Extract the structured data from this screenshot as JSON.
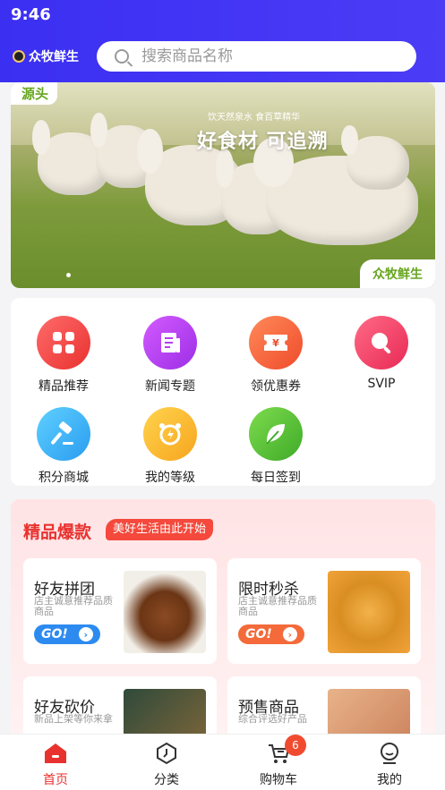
{
  "status": {
    "time": "9:46"
  },
  "header": {
    "brand": "众牧鲜生"
  },
  "search": {
    "placeholder": "搜索商品名称"
  },
  "banner": {
    "corner_tag": "源头",
    "subtitle": "饮天然泉水 食百草精华",
    "title": "好食材 可追溯",
    "brand": "众牧鲜生"
  },
  "menu": [
    {
      "label": "精品推荐",
      "icon": "grid-icon",
      "color": "#f24a4a"
    },
    {
      "label": "新闻专题",
      "icon": "news-icon",
      "color": "#b53ef0"
    },
    {
      "label": "领优惠券",
      "icon": "coupon-icon",
      "color": "#f46a3a"
    },
    {
      "label": "SVIP",
      "icon": "search-vip-icon",
      "color": "#f03d62"
    },
    {
      "label": "积分商城",
      "icon": "hammer-icon",
      "color": "#3ab6f4"
    },
    {
      "label": "我的等级",
      "icon": "alarm-icon",
      "color": "#f7b733"
    },
    {
      "label": "每日签到",
      "icon": "leaf-icon",
      "color": "#5fc23b"
    }
  ],
  "featured": {
    "title": "精品爆款",
    "tag": "美好生活由此开始",
    "promos": [
      {
        "title": "好友拼团",
        "desc": "店主诚意推荐品质商品",
        "go": "GO!",
        "go_color": "#2d8bf0"
      },
      {
        "title": "限时秒杀",
        "desc": "店主诚意推荐品质商品",
        "go": "GO!",
        "go_color": "#f46a3a"
      },
      {
        "title": "好友砍价",
        "desc": "新品上架等你来拿"
      },
      {
        "title": "预售商品",
        "desc": "综合评选好产品"
      }
    ]
  },
  "tabbar": {
    "items": [
      {
        "label": "首页",
        "icon": "home-icon",
        "active": true
      },
      {
        "label": "分类",
        "icon": "category-icon"
      },
      {
        "label": "购物车",
        "icon": "cart-icon",
        "badge": "6"
      },
      {
        "label": "我的",
        "icon": "profile-icon"
      }
    ]
  },
  "colors": {
    "header": "#3b2ff2",
    "accent": "#e8322f"
  }
}
